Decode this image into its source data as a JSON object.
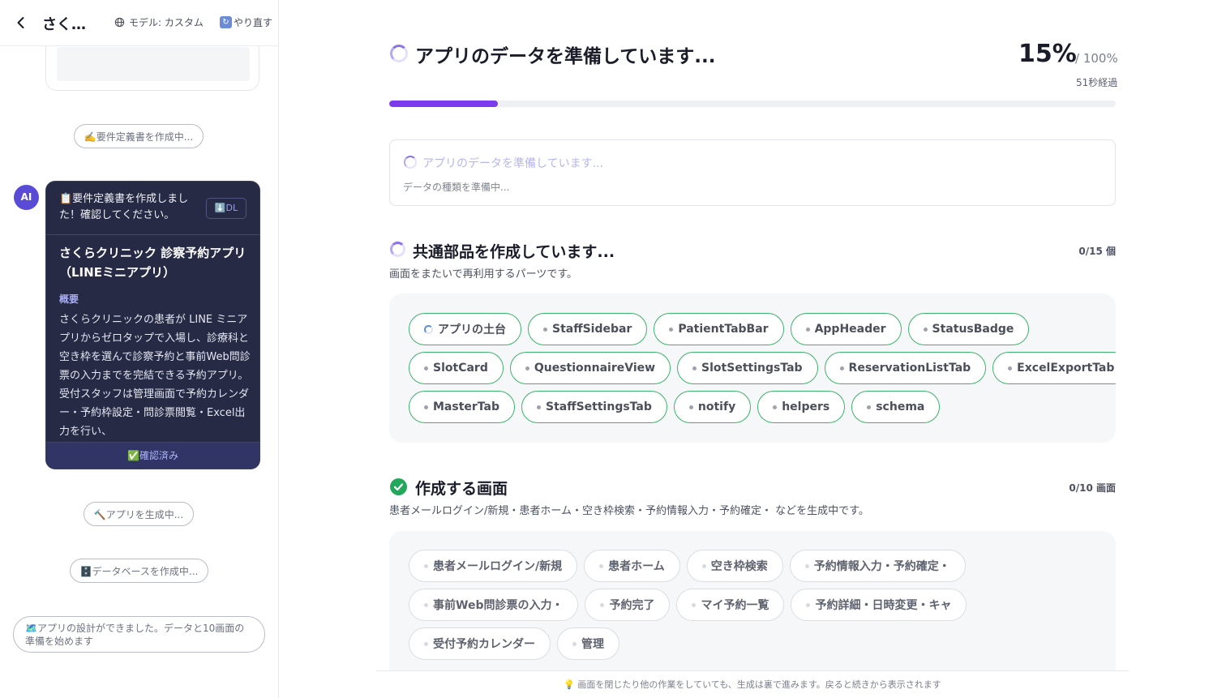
{
  "topbar": {
    "app_name": "さくら...",
    "model_label": "モデル: カスタム",
    "redo_label": "やり直す"
  },
  "chat": {
    "status_writing_spec": "✍️要件定義書を作成中...",
    "ai_avatar": "AI",
    "spec_card": {
      "message": "📋要件定義書を作成しました！確認してください。",
      "download_label": "⬇️DL",
      "title": "さくらクリニック 診察予約アプリ（LINEミニアプリ）",
      "section_label": "概要",
      "body": "さくらクリニックの患者が LINE ミニアプリからゼロタップで入場し、診療科と空き枠を選んで診察予約と事前Web問診票の入力までを完結できる予約アプリ。受付スタッフは管理画面で予約カレンダー・予約枠設定・問診票閲覧・Excel出力を行い、",
      "confirmed_label": "✅確認済み"
    },
    "status_generating_app": "🔨アプリを生成中...",
    "status_creating_db": "🗄️データベースを作成中...",
    "design_done": "🗺️アプリの設計ができました。データと10画面の準備を始めます"
  },
  "main": {
    "heading": "アプリのデータを準備しています...",
    "percent_label": "15%",
    "percent_total": "/ 100%",
    "progress": 15,
    "elapsed": "51秒経過",
    "data_box": {
      "title": "アプリのデータを準備しています...",
      "subtitle": "データの種類を準備中..."
    },
    "components": {
      "title": "共通部品を作成しています...",
      "count": "0/15 個",
      "description": "画面をまたいで再利用するパーツです。",
      "rows": [
        [
          "アプリの土台",
          "StaffSidebar",
          "PatientTabBar",
          "AppHeader",
          "StatusBadge"
        ],
        [
          "SlotCard",
          "QuestionnaireView",
          "SlotSettingsTab",
          "ReservationListTab",
          "ExcelExportTab"
        ],
        [
          "MasterTab",
          "StaffSettingsTab",
          "notify",
          "helpers",
          "schema"
        ]
      ]
    },
    "screens": {
      "title": "作成する画面",
      "count": "0/10 画面",
      "description": "患者メールログイン/新規・患者ホーム・空き枠検索・予約情報入力・予約確定・ などを生成中です。",
      "rows": [
        [
          "患者メールログイン/新規",
          "患者ホーム",
          "空き枠検索",
          "予約情報入力・予約確定・"
        ],
        [
          "事前Web問診票の入力・",
          "予約完了",
          "マイ予約一覧",
          "予約詳細・日時変更・キャ"
        ],
        [
          "受付予約カレンダー",
          "管理"
        ]
      ]
    },
    "footer_note": "💡 画面を閉じたり他の作業をしていても、生成は裏で進みます。戻ると続きから表示されます"
  },
  "colors": {
    "accent": "#7c3aed",
    "chip_border": "#3bb36b",
    "success": "#22a85a",
    "spec_card_bg": "#262a44"
  },
  "icons": [
    "back-chevron-icon",
    "globe-icon",
    "redo-icon",
    "spinner-icon",
    "check-circle-icon",
    "lightbulb-icon"
  ]
}
